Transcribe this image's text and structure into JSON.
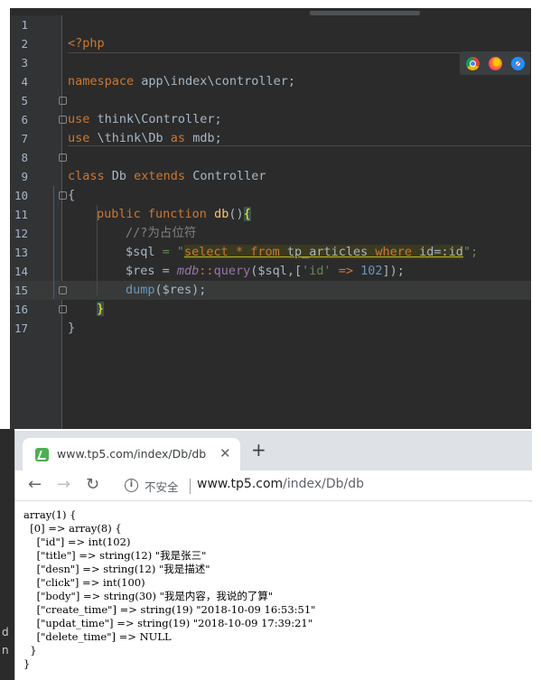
{
  "editor": {
    "lines": [
      {
        "num": "1"
      },
      {
        "num": "2"
      },
      {
        "num": "3"
      },
      {
        "num": "4"
      },
      {
        "num": "5"
      },
      {
        "num": "6"
      },
      {
        "num": "7"
      },
      {
        "num": "8"
      },
      {
        "num": "9"
      },
      {
        "num": "10"
      },
      {
        "num": "11"
      },
      {
        "num": "12"
      },
      {
        "num": "13"
      },
      {
        "num": "14"
      },
      {
        "num": "15"
      },
      {
        "num": "16"
      },
      {
        "num": "17"
      }
    ],
    "code": {
      "l1_open": "<?php",
      "l3_kw": "namespace",
      "l3_rest": " app\\index\\controller;",
      "l5_kw": "use",
      "l5_rest": " think\\Controller;",
      "l6_kw": "use",
      "l6_rest": " \\think\\Db ",
      "l6_as": "as",
      "l6_alias": " mdb;",
      "l8_kw": "class",
      "l8_name": " Db ",
      "l8_ext": "extends",
      "l8_parent": " Controller",
      "l9": "{",
      "l10_pub": "public",
      "l10_function": " function ",
      "l10_name": "db",
      "l10_paren": "()",
      "l10_brace": "{",
      "l11_comment": "//?为占位符",
      "l12_var": "$sql",
      "l12_eq": " = \"",
      "l12_select": "select",
      "l12_star": " * ",
      "l12_from": "from",
      "l12_table": " tp_articles ",
      "l12_where": "where",
      "l12_cond": " id=:id",
      "l12_end": "\";",
      "l13_var": "$res",
      "l13_eq": " = ",
      "l13_mdb": "mdb",
      "l13_sep": "::",
      "l13_query": "query",
      "l13_args1": "($sql,[",
      "l13_str": "'id'",
      "l13_arrow": " => ",
      "l13_num": "102",
      "l13_end": "]);",
      "l14_dump": "dump",
      "l14_args": "($res);",
      "l15_brace": "}",
      "l16": "}"
    },
    "browser_icons": [
      "chrome-icon",
      "firefox-icon",
      "safari-icon"
    ]
  },
  "browser": {
    "tab_title": "www.tp5.com/index/Db/db",
    "tab_close": "✕",
    "new_tab": "+",
    "back": "←",
    "forward": "→",
    "reload": "↻",
    "info": "i",
    "insecure_label": "不安全",
    "url_host": "www.tp5.com",
    "url_path": "/index/Db/db",
    "output": [
      "array(1) {",
      "  [0] => array(8) {",
      "    [\"id\"] => int(102)",
      "    [\"title\"] => string(12) \"我是张三\"",
      "    [\"desn\"] => string(12) \"我是描述\"",
      "    [\"click\"] => int(100)",
      "    [\"body\"] => string(30) \"我是内容，我说的了算\"",
      "    [\"create_time\"] => string(19) \"2018-10-09 16:53:51\"",
      "    [\"updat_time\"] => string(19) \"2018-10-09 17:39:21\"",
      "    [\"delete_time\"] => NULL",
      "  }",
      "}"
    ]
  },
  "left_edge": [
    "d",
    "n"
  ],
  "colors": {
    "editor_bg": "#2b2b2b",
    "keyword": "#cc7832",
    "string": "#6a8759",
    "number": "#6897bb",
    "function": "#ffc66d"
  }
}
